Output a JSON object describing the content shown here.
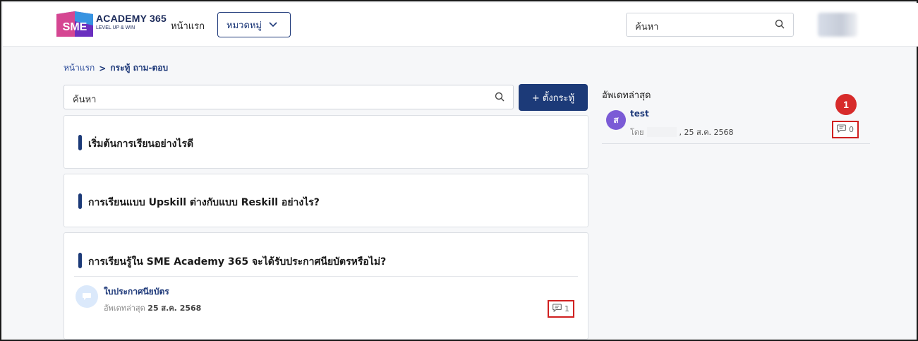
{
  "header": {
    "logo_title": "ACADEMY 365",
    "logo_sub": "LEVEL UP & WIN",
    "logo_mark": "SME",
    "nav_home": "หน้าแรก",
    "category_label": "หมวดหมู่",
    "search_placeholder": "ค้นหา"
  },
  "breadcrumb": {
    "home": "หน้าแรก",
    "separator": ">",
    "current": "กระทู้ ถาม-ตอบ"
  },
  "main": {
    "search_placeholder": "ค้นหา",
    "new_topic_label": "+ ตั้งกระทู้",
    "topics": [
      {
        "title": "เริ่มต้นการเรียนอย่างไรดี"
      },
      {
        "title": "การเรียนแบบ Upskill ต่างกับแบบ Reskill อย่างไร?"
      },
      {
        "title": "การเรียนรู้ใน SME Academy 365 จะได้รับประกาศนียบัตรหรือไม่?",
        "sub_title": "ใบประกาศนียบัตร",
        "sub_meta_label": "อัพเดทล่าสุด",
        "sub_meta_date": "25 ส.ค. 2568",
        "comment_count": "1"
      }
    ]
  },
  "sidebar": {
    "title": "อัพเดทล่าสุด",
    "item": {
      "avatar_letter": "ส",
      "name": "test",
      "by_label": "โดย",
      "date": ", 25 ส.ค. 2568",
      "comment_count": "0"
    },
    "annotation_badge": "1"
  },
  "colors": {
    "primary": "#1c3a78",
    "accent_red": "#d72b2b",
    "avatar_purple": "#7b5bd6"
  }
}
